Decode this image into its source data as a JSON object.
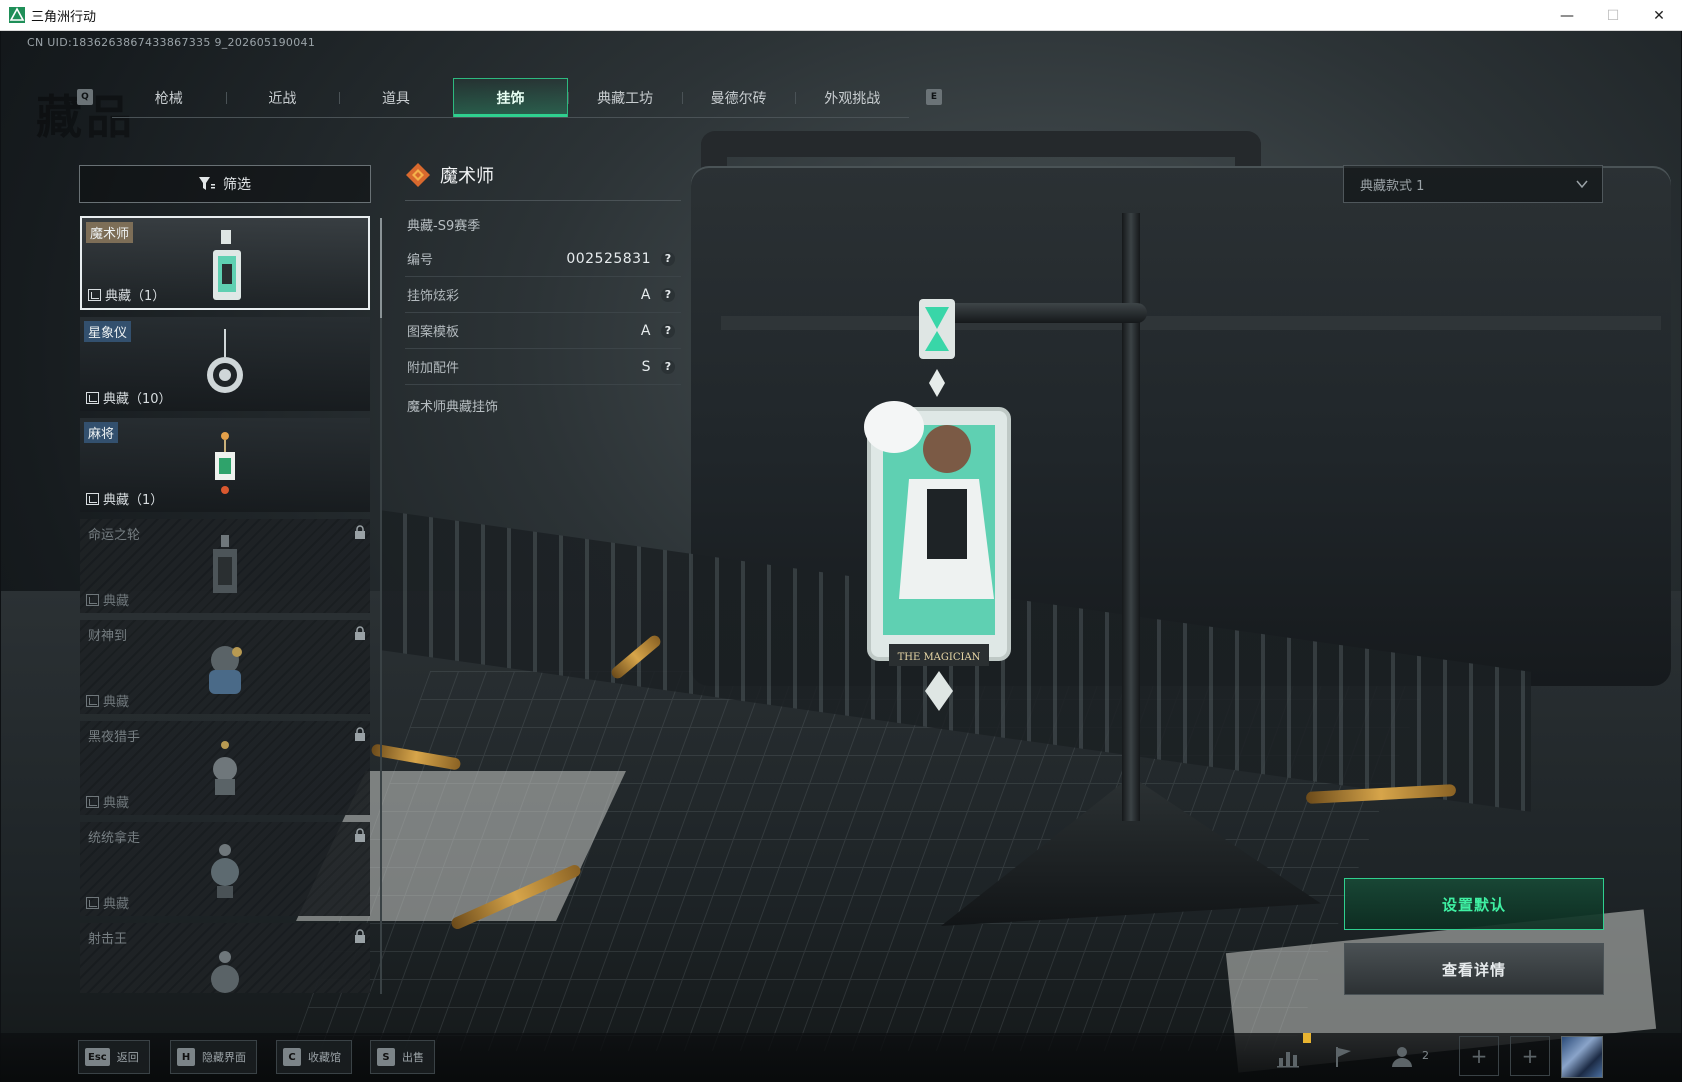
{
  "window": {
    "title": "三角洲行动",
    "controls": {
      "minimize": "—",
      "maximize": "☐",
      "close": "✕"
    }
  },
  "account": {
    "uid": "CN UID:1836263867433867335 9_202605190041"
  },
  "header": {
    "watermark_text": "藏品"
  },
  "tabs": {
    "prev_key": "Q",
    "next_key": "E",
    "items": [
      "枪械",
      "近战",
      "道具",
      "挂饰",
      "典藏工坊",
      "曼德尔砖",
      "外观挑战"
    ],
    "active": "挂饰"
  },
  "filter": {
    "label": "筛选"
  },
  "charm_list": [
    {
      "name": "魔术师",
      "tier": "典藏（1）",
      "selected": true,
      "locked": false,
      "tag": "tan"
    },
    {
      "name": "星象仪",
      "tier": "典藏（10）",
      "selected": false,
      "locked": false,
      "tag": "blue"
    },
    {
      "name": "麻将",
      "tier": "典藏（1）",
      "selected": false,
      "locked": false,
      "tag": "blue"
    },
    {
      "name": "命运之轮",
      "tier": "典藏",
      "selected": false,
      "locked": true
    },
    {
      "name": "财神到",
      "tier": "典藏",
      "selected": false,
      "locked": true
    },
    {
      "name": "黑夜猎手",
      "tier": "典藏",
      "selected": false,
      "locked": true
    },
    {
      "name": "统统拿走",
      "tier": "典藏",
      "selected": false,
      "locked": true
    },
    {
      "name": "射击王",
      "tier": "",
      "selected": false,
      "locked": true
    }
  ],
  "detail": {
    "title": "魔术师",
    "season": "典藏-S9赛季",
    "rows": [
      {
        "label": "编号",
        "value": "002525831",
        "help": "?"
      },
      {
        "label": "挂饰炫彩",
        "value": "A",
        "help": "?"
      },
      {
        "label": "图案模板",
        "value": "A",
        "help": "?"
      },
      {
        "label": "附加配件",
        "value": "S",
        "help": "?"
      }
    ],
    "description": "魔术师典藏挂饰"
  },
  "style_select": {
    "selected": "典藏款式 1"
  },
  "actions": {
    "set_default": "设置默认",
    "view_details": "查看详情"
  },
  "bottom_hints": [
    {
      "key": "Esc",
      "label": "返回"
    },
    {
      "key": "H",
      "label": "隐藏界面"
    },
    {
      "key": "C",
      "label": "收藏馆"
    },
    {
      "key": "S",
      "label": "出售"
    }
  ],
  "tray": {
    "friends_count": "2",
    "add_slot": "+",
    "icons": [
      "stats-icon",
      "flag-icon",
      "friends-icon"
    ]
  },
  "colors": {
    "accent_green": "#2fd08f",
    "tag_tan": "#7d6e57",
    "tag_blue": "#33506e"
  },
  "charm_art": {
    "card_caption": "THE MAGICIAN"
  }
}
